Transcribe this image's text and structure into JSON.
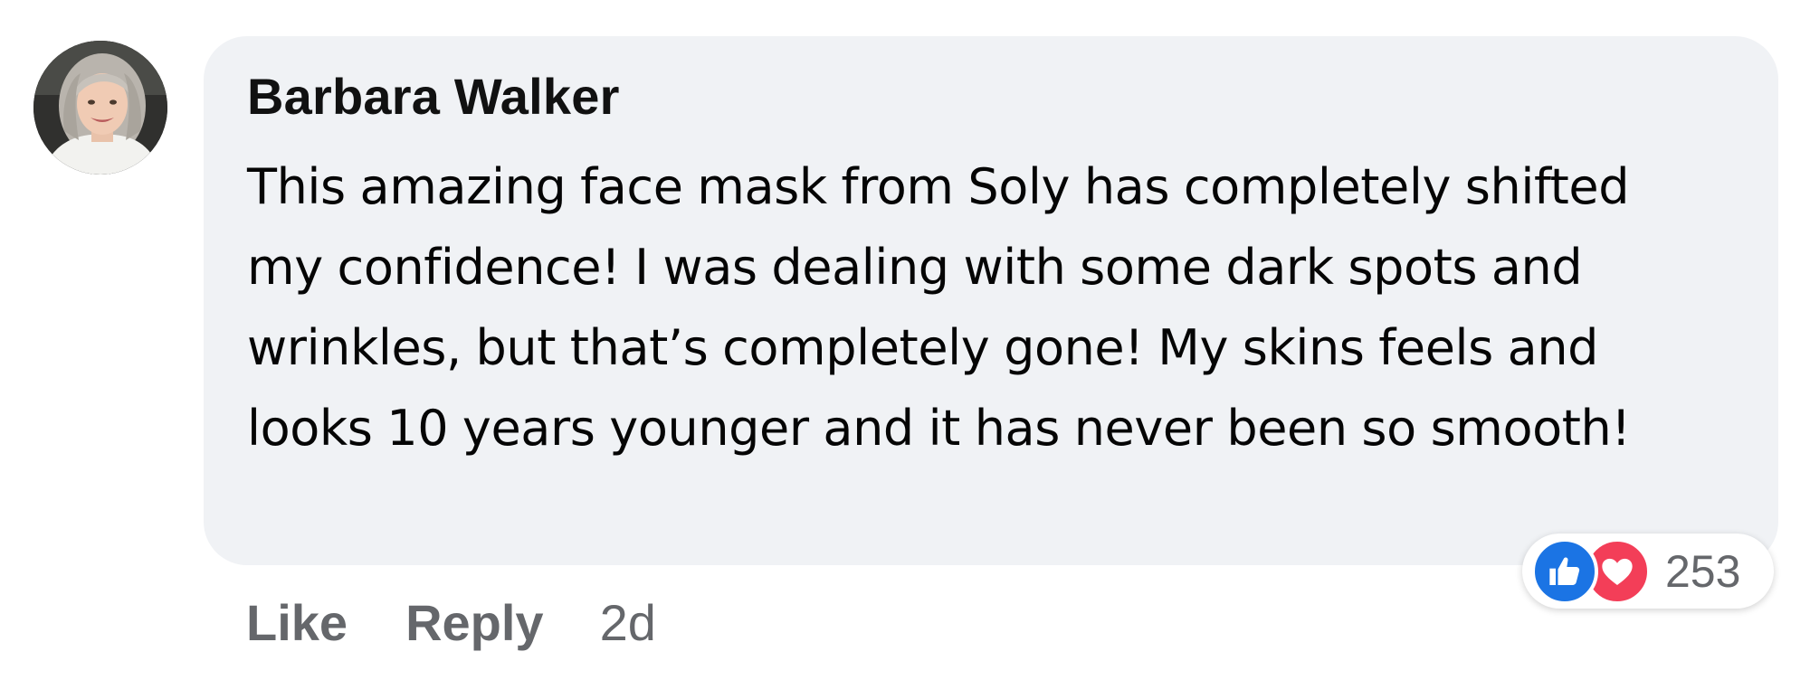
{
  "comment": {
    "author": "Barbara Walker",
    "text": "This amazing face mask from Soly has completely shifted my confidence! I was dealing with some dark spots and wrinkles, but that’s completely gone! My skins feels and looks 10 years younger and it has never been so smooth!",
    "avatar_icon": "profile-photo",
    "reactions": {
      "icons": [
        "like-icon",
        "love-icon"
      ],
      "count": "253",
      "like_color": "#1b74e4",
      "love_color": "#f33e58"
    },
    "actions": {
      "like_label": "Like",
      "reply_label": "Reply",
      "timestamp": "2d"
    },
    "bubble_color": "#f0f2f5"
  }
}
